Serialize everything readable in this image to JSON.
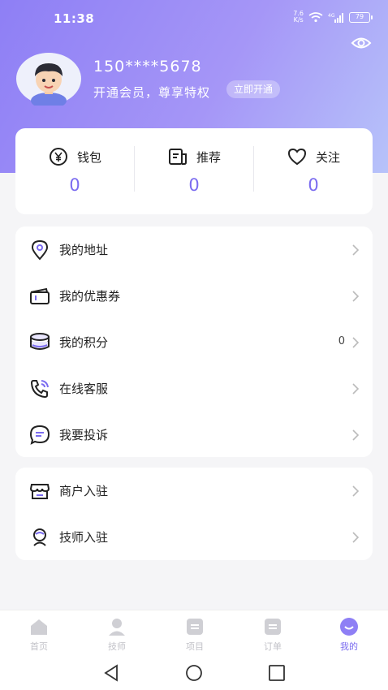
{
  "status_bar": {
    "time": "11:38",
    "net_speed_value": "7.6",
    "net_speed_unit": "K/s",
    "battery": "79"
  },
  "profile": {
    "phone": "150****5678",
    "vip_text": "开通会员，尊享特权",
    "vip_button": "立即开通"
  },
  "stats": [
    {
      "label": "钱包",
      "value": "0",
      "icon": "yen-wallet-icon"
    },
    {
      "label": "推荐",
      "value": "0",
      "icon": "recommend-doc-icon"
    },
    {
      "label": "关注",
      "value": "0",
      "icon": "heart-icon"
    }
  ],
  "menu_group_1": [
    {
      "label": "我的地址",
      "icon": "location-icon",
      "value": ""
    },
    {
      "label": "我的优惠券",
      "icon": "coupon-icon",
      "value": ""
    },
    {
      "label": "我的积分",
      "icon": "points-coins-icon",
      "value": "0"
    },
    {
      "label": "在线客服",
      "icon": "phone-service-icon",
      "value": ""
    },
    {
      "label": "我要投诉",
      "icon": "chat-complaint-icon",
      "value": ""
    }
  ],
  "menu_group_2": [
    {
      "label": "商户入驻",
      "icon": "store-icon"
    },
    {
      "label": "技师入驻",
      "icon": "technician-icon"
    }
  ],
  "tabs": [
    {
      "label": "首页",
      "icon": "home-icon",
      "active": false
    },
    {
      "label": "技师",
      "icon": "technician-tab-icon",
      "active": false
    },
    {
      "label": "项目",
      "icon": "project-icon",
      "active": false
    },
    {
      "label": "订单",
      "icon": "order-icon",
      "active": false
    },
    {
      "label": "我的",
      "icon": "mine-smile-icon",
      "active": true
    }
  ],
  "colors": {
    "accent": "#7b6cf0",
    "header_start": "#8e7ff5",
    "header_end": "#b7c3fa",
    "tab_inactive": "#c2c2c8"
  }
}
